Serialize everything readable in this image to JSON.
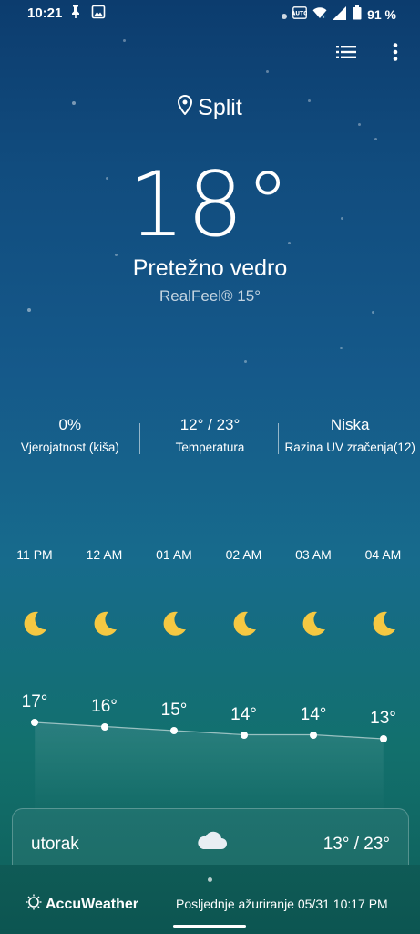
{
  "status_bar": {
    "time": "10:21",
    "battery": "91 %",
    "icons": [
      "pin-icon",
      "image-icon",
      "dot-icon",
      "auto-icon",
      "wifi-icon",
      "signal-icon",
      "battery-icon"
    ]
  },
  "toolbar": {
    "icons": [
      "list-icon",
      "more-vert-icon"
    ]
  },
  "location": {
    "name": "Split",
    "icon": "location-pin-icon"
  },
  "current": {
    "temperature": "18°",
    "condition": "Pretežno vedro",
    "realfeel": "RealFeel® 15°"
  },
  "stats": [
    {
      "value": "0%",
      "label": "Vjerojatnost (kiša)"
    },
    {
      "value": "12° / 23°",
      "label": "Temperatura"
    },
    {
      "value": "Niska",
      "label": "Razina UV zračenja(12)"
    }
  ],
  "hourly": [
    {
      "time": "11 PM",
      "icon": "moon-icon",
      "temp": "17°",
      "value": 17
    },
    {
      "time": "12 AM",
      "icon": "moon-icon",
      "temp": "16°",
      "value": 16
    },
    {
      "time": "01 AM",
      "icon": "moon-icon",
      "temp": "15°",
      "value": 15
    },
    {
      "time": "02 AM",
      "icon": "moon-icon",
      "temp": "14°",
      "value": 14
    },
    {
      "time": "03 AM",
      "icon": "moon-icon",
      "temp": "14°",
      "value": 14
    },
    {
      "time": "04 AM",
      "icon": "moon-icon",
      "temp": "13°",
      "value": 13
    }
  ],
  "forecast": {
    "day": "utorak",
    "icon": "cloud-icon",
    "temps": "13° / 23°"
  },
  "footer": {
    "brand": "AccuWeather",
    "updated": "Posljednje ažuriranje 05/31 10:17 PM"
  },
  "colors": {
    "moon": "#f5c842",
    "background_top": "#0c3c6e",
    "background_bottom": "#0f5e58"
  }
}
